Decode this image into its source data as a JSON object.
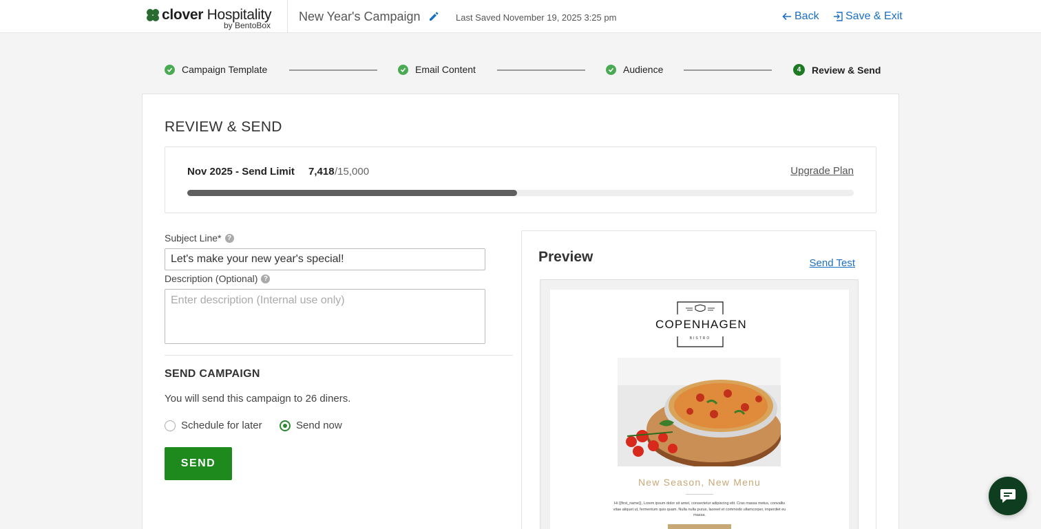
{
  "header": {
    "brand": "clover",
    "brand_rest": " Hospitality",
    "brand_sub": "by BentoBox",
    "campaign_title": "New Year's Campaign",
    "last_saved": "Last Saved November 19, 2025 3:25 pm",
    "back_label": "Back",
    "save_exit_label": "Save & Exit",
    "icons": {
      "edit": "pencil-icon",
      "back": "arrow-left-icon",
      "save_exit": "exit-icon"
    }
  },
  "stepper": {
    "steps": [
      {
        "label": "Campaign Template",
        "status": "complete"
      },
      {
        "label": "Email Content",
        "status": "complete"
      },
      {
        "label": "Audience",
        "status": "complete"
      },
      {
        "label": "Review & Send",
        "status": "active",
        "number": "4"
      }
    ]
  },
  "main": {
    "title": "REVIEW & SEND",
    "send_limit": {
      "label": "Nov 2025 - Send Limit",
      "used": "7,418",
      "total": "/15,000",
      "progress_fraction": 0.4945,
      "upgrade_label": "Upgrade Plan"
    },
    "subject": {
      "label": "Subject Line*",
      "value": "Let's make your new year's special!"
    },
    "description": {
      "label": "Description (Optional)",
      "placeholder": "Enter description (Internal use only)",
      "value": ""
    },
    "send_campaign": {
      "title": "SEND CAMPAIGN",
      "info": "You will send this campaign to 26 diners.",
      "options": [
        {
          "label": "Schedule for later",
          "selected": false
        },
        {
          "label": "Send now",
          "selected": true
        }
      ],
      "send_label": "SEND"
    }
  },
  "preview": {
    "title": "Preview",
    "send_test_label": "Send Test",
    "email": {
      "restaurant_name": "COPENHAGEN",
      "restaurant_sub": "BISTRO",
      "headline": "New Season, New Menu",
      "body": "Hi {{first_name}}, Lorem ipsum dolor sit amet, consectetur adipiscing elit. Cras massa metus, convallis vitae aliquet ut, fermentum quis quam. Nulla nulla purus, laoreet et commodo ullamcorper, imperdiet eu massa."
    }
  },
  "colors": {
    "accent_blue": "#1a6fc4",
    "brand_green": "#1e8a1e",
    "step_check_green": "#4aaa52",
    "headline_gold": "#c8a877",
    "chat_bg": "#0f3d1f"
  },
  "chat": {
    "icon": "chat-bubble-icon"
  }
}
